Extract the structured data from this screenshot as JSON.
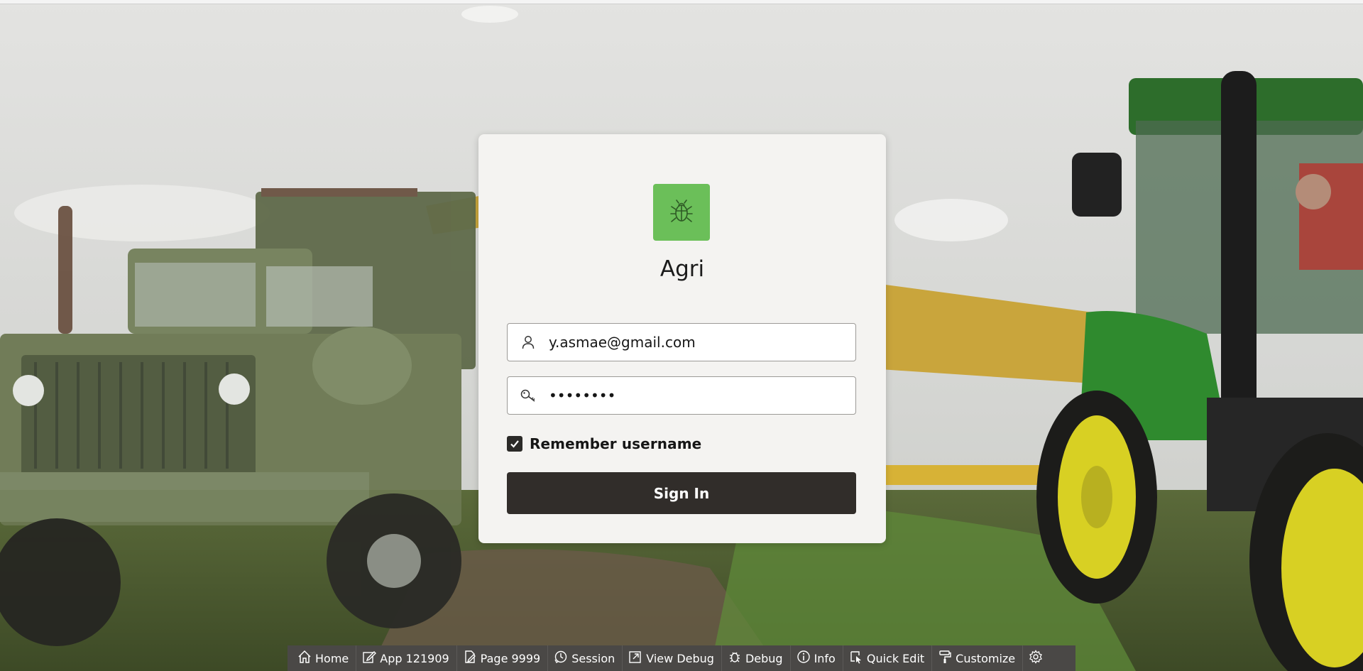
{
  "app": {
    "title": "Agri",
    "logo_icon": "bug-icon",
    "accent_color": "#6bbf59"
  },
  "login": {
    "username_value": "y.asmae@gmail.com",
    "password_masked": "••••••••",
    "remember_label": "Remember username",
    "remember_checked": true,
    "signin_label": "Sign In"
  },
  "dev_toolbar": {
    "items": [
      {
        "label": "Home",
        "icon": "home-icon"
      },
      {
        "label": "App 121909",
        "icon": "edit-icon"
      },
      {
        "label": "Page 9999",
        "icon": "page-edit-icon"
      },
      {
        "label": "Session",
        "icon": "session-icon"
      },
      {
        "label": "View Debug",
        "icon": "view-debug-icon"
      },
      {
        "label": "Debug",
        "icon": "debug-icon"
      },
      {
        "label": "Info",
        "icon": "info-icon"
      },
      {
        "label": "Quick Edit",
        "icon": "quick-edit-icon"
      },
      {
        "label": "Customize",
        "icon": "customize-icon"
      }
    ],
    "settings_icon": "gear-icon"
  },
  "background": {
    "description_icon": "farm-background-image"
  }
}
